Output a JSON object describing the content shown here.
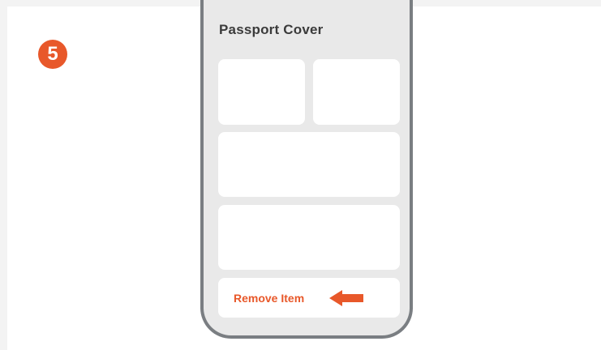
{
  "step": {
    "number": "5"
  },
  "phone": {
    "title": "Passport Cover",
    "remove_button_label": "Remove Item",
    "arrow_icon": "left-arrow-icon"
  },
  "colors": {
    "accent": "#e8582a",
    "phone_frame": "#7a7e82",
    "phone_background": "#e9e9e9",
    "panel": "#ffffff",
    "title_text": "#3b3b3b"
  }
}
